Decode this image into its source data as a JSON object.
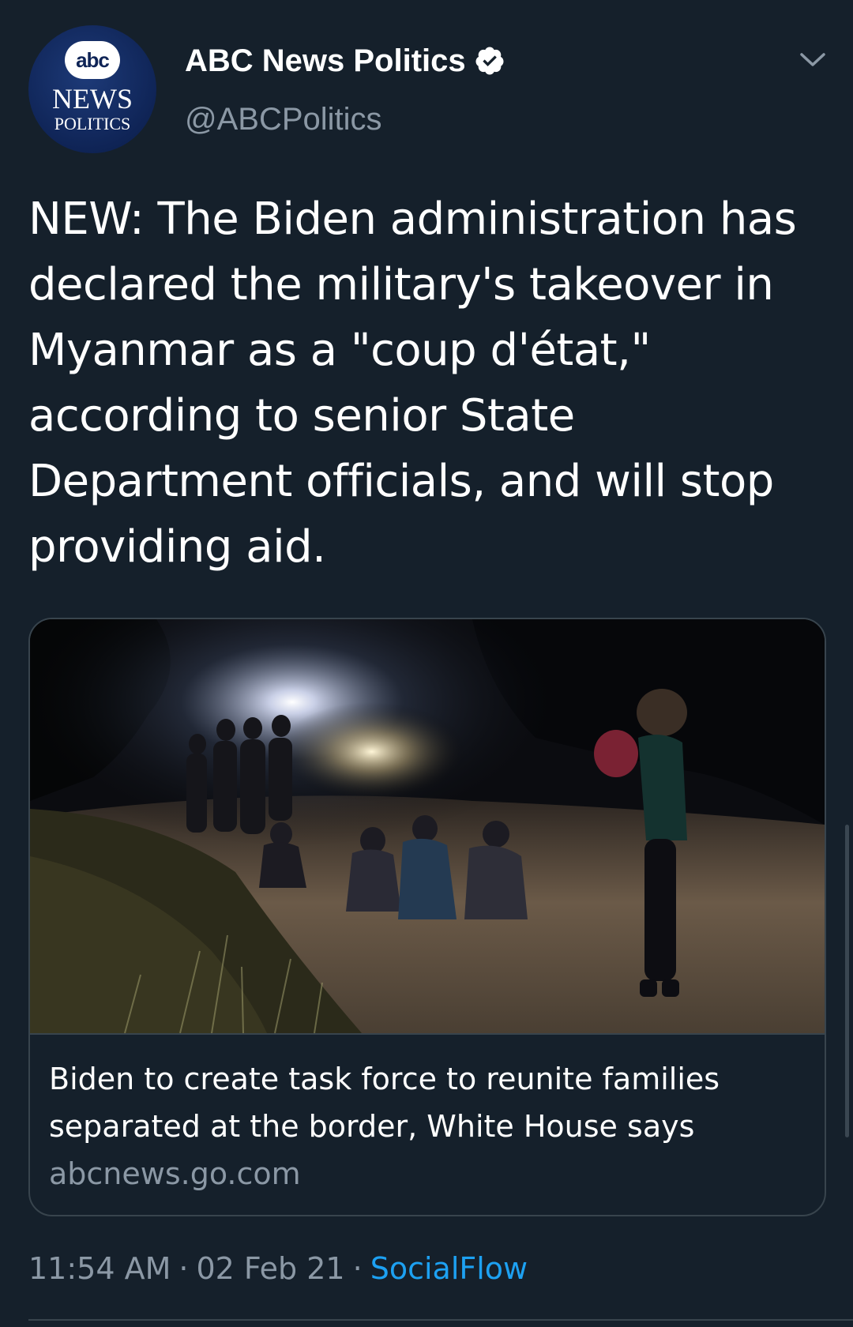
{
  "account": {
    "display_name": "ABC News Politics",
    "handle": "@ABCPolitics",
    "avatar": {
      "logo_text": "abc",
      "line1": "NEWS",
      "line2": "POLITICS"
    },
    "verified": true
  },
  "tweet": {
    "text": "NEW: The Biden administration has declared the military's takeover in Myanmar as a \"coup d'état,\" according to senior State Department officials, and will stop providing aid."
  },
  "card": {
    "title": "Biden to create task force to reunite families separated at the border, White House says",
    "domain": "abcnews.go.com"
  },
  "meta": {
    "time": "11:54 AM",
    "date": "02 Feb 21",
    "separator": "·",
    "source": "SocialFlow"
  },
  "icons": {
    "verified": "verified-badge-icon",
    "menu": "chevron-down-icon"
  },
  "colors": {
    "background": "#15202b",
    "primary_text": "#ffffff",
    "secondary_text": "#8b98a5",
    "accent": "#1da1f2",
    "border": "#38444d"
  }
}
